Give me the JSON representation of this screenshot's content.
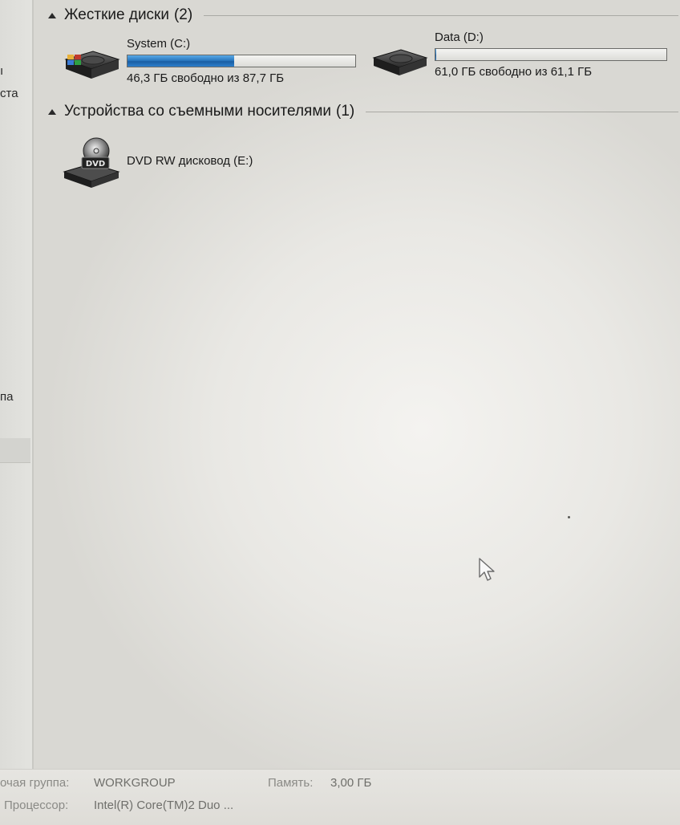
{
  "nav": {
    "fragments": [
      "ста",
      "па"
    ]
  },
  "groups": {
    "hard_disks": {
      "title": "Жесткие диски",
      "count": "(2)",
      "drives": [
        {
          "name": "System (C:)",
          "free_text": "46,3 ГБ свободно из 87,7 ГБ",
          "used_fraction": 0.47,
          "icon": "system-drive-icon"
        },
        {
          "name": "Data (D:)",
          "free_text": "61,0 ГБ свободно из 61,1 ГБ",
          "used_fraction": 0.002,
          "icon": "hard-drive-icon"
        }
      ]
    },
    "removable": {
      "title": "Устройства со съемными носителями",
      "count": "(1)",
      "drives": [
        {
          "name": "DVD RW дисковод (E:)",
          "icon": "dvd-drive-icon",
          "icon_label": "DVD"
        }
      ]
    }
  },
  "status": {
    "workgroup_label": "очая группа:",
    "workgroup_value": "WORKGROUP",
    "memory_label": "Память:",
    "memory_value": "3,00 ГБ",
    "cpu_label": "Процессор:",
    "cpu_value": "Intel(R) Core(TM)2 Duo ..."
  },
  "colors": {
    "bar_fill": "#2a79c0",
    "background": "#ecebe7"
  }
}
